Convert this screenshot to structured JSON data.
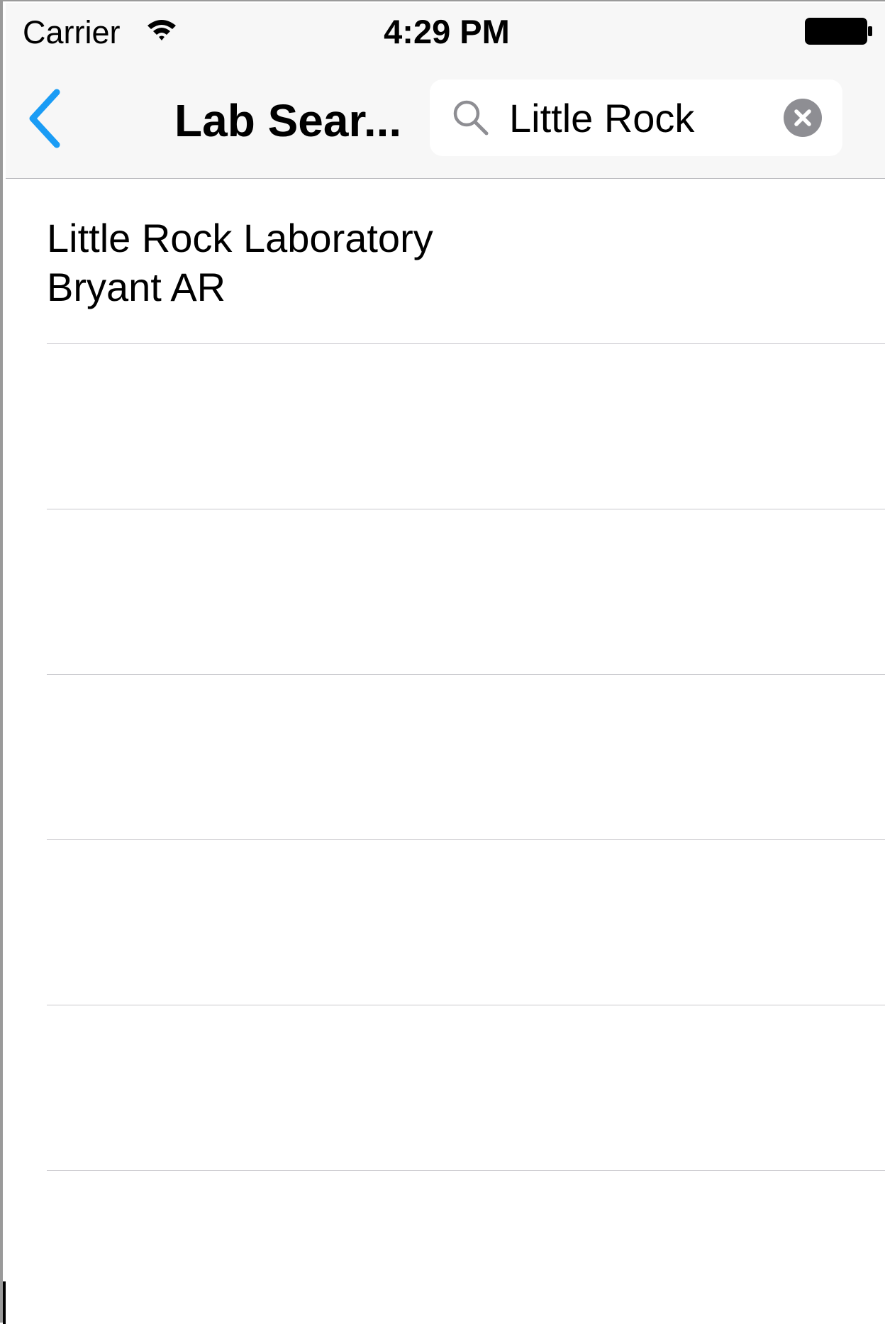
{
  "status_bar": {
    "carrier": "Carrier",
    "time": "4:29 PM",
    "wifi_icon": "wifi-icon",
    "battery_icon": "battery-full-icon"
  },
  "nav": {
    "back_icon": "chevron-left-icon",
    "title": "Lab Sear...",
    "accent_color": "#1a9cf5"
  },
  "search": {
    "value": "Little Rock",
    "search_icon": "magnifier-icon",
    "clear_icon": "clear-circle-icon"
  },
  "results": [
    {
      "title": "Little Rock Laboratory",
      "subtitle": "Bryant AR"
    },
    {
      "title": "",
      "subtitle": ""
    },
    {
      "title": "",
      "subtitle": ""
    },
    {
      "title": "",
      "subtitle": ""
    },
    {
      "title": "",
      "subtitle": ""
    },
    {
      "title": "",
      "subtitle": ""
    },
    {
      "title": "",
      "subtitle": ""
    }
  ]
}
